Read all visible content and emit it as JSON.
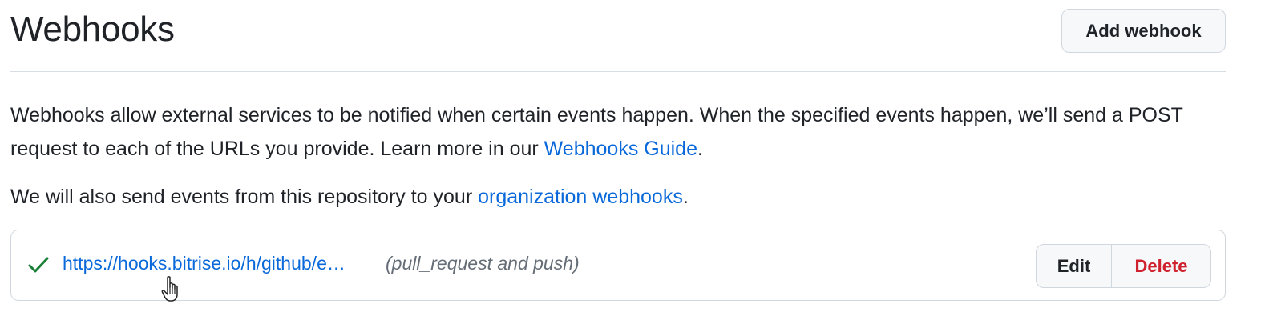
{
  "header": {
    "title": "Webhooks",
    "add_button_label": "Add webhook"
  },
  "description": {
    "line1_text": "Webhooks allow external services to be notified when certain events happen. When the specified events happen, we’ll send a POST request to each of the URLs you provide. Learn more in our ",
    "guide_link": "Webhooks Guide",
    "line1_end": ".",
    "line2_text": "We will also send events from this repository to your ",
    "org_link": "organization webhooks",
    "line2_end": "."
  },
  "webhooks": [
    {
      "status_icon": "check-icon",
      "url": "https://hooks.bitrise.io/h/github/e…",
      "events": "(pull_request and push)",
      "edit_label": "Edit",
      "delete_label": "Delete"
    }
  ],
  "colors": {
    "link": "#0969da",
    "success": "#1a7f37",
    "danger": "#cf222e",
    "muted": "#656d76",
    "border": "#d0d7de"
  }
}
